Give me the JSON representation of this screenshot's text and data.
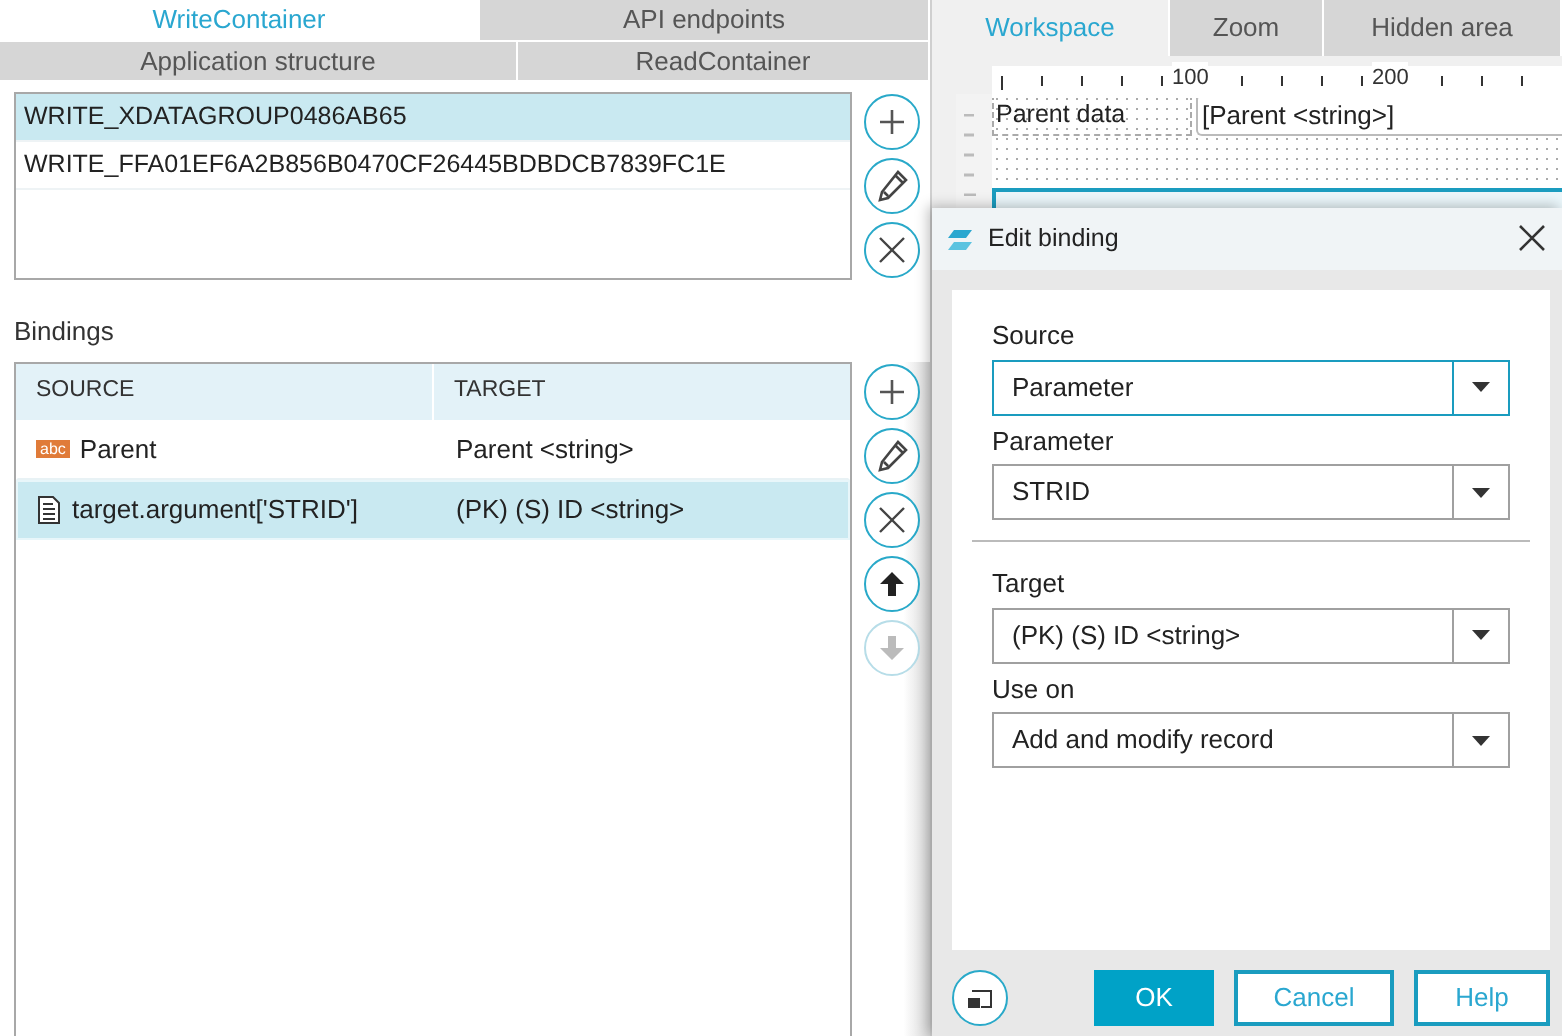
{
  "tab_rows": [
    {
      "tabs": [
        {
          "label": "WriteContainer",
          "selected": true
        },
        {
          "label": "API endpoints",
          "selected": false
        }
      ]
    },
    {
      "tabs": [
        {
          "label": "Application structure",
          "selected": false
        },
        {
          "label": "ReadContainer",
          "selected": false
        }
      ]
    }
  ],
  "containers": [
    {
      "label": "WRITE_XDATAGROUP0486AB65",
      "selected": true
    },
    {
      "label": "WRITE_FFA01EF6A2B856B0470CF26445BDBDCB7839FC1E",
      "selected": false
    }
  ],
  "container_buttons": [
    {
      "kind": "add",
      "disabled": false
    },
    {
      "kind": "edit",
      "disabled": false
    },
    {
      "kind": "delete",
      "disabled": false
    }
  ],
  "bindings": {
    "label": "Bindings",
    "columns": [
      "SOURCE",
      "TARGET"
    ],
    "rows": [
      {
        "kind": "text",
        "badge": "abc",
        "source": "Parent",
        "target": "Parent <string>",
        "selected": false
      },
      {
        "kind": "parameter",
        "source": "target.argument['STRID']",
        "target": "(PK) (S) ID <string>",
        "selected": true
      }
    ]
  },
  "binding_buttons": [
    {
      "kind": "add",
      "disabled": false
    },
    {
      "kind": "edit",
      "disabled": false
    },
    {
      "kind": "delete",
      "disabled": false
    },
    {
      "kind": "up",
      "disabled": false
    },
    {
      "kind": "down",
      "disabled": true
    }
  ],
  "workspace_tabs": [
    {
      "label": "Workspace",
      "selected": true
    },
    {
      "label": "Zoom",
      "selected": false
    },
    {
      "label": "Hidden area",
      "selected": false
    }
  ],
  "ruler": {
    "labels": [
      "100",
      "200"
    ]
  },
  "canvas": {
    "label": "Parent data",
    "field": "[Parent <string>]"
  },
  "dialog": {
    "title": "Edit binding",
    "groups": [
      {
        "fields": [
          {
            "label": "Source",
            "value": "Parameter",
            "focused": true
          },
          {
            "label": "Parameter",
            "value": "STRID",
            "focused": false
          }
        ]
      },
      {
        "fields": [
          {
            "label": "Target",
            "value": "(PK) (S) ID <string>",
            "focused": false
          },
          {
            "label": "Use on",
            "value": "Add and modify record",
            "focused": false
          }
        ]
      }
    ],
    "buttons": [
      {
        "label": "OK",
        "kind": "primary"
      },
      {
        "label": "Cancel",
        "kind": "secondary"
      },
      {
        "label": "Help",
        "kind": "secondary"
      }
    ]
  }
}
